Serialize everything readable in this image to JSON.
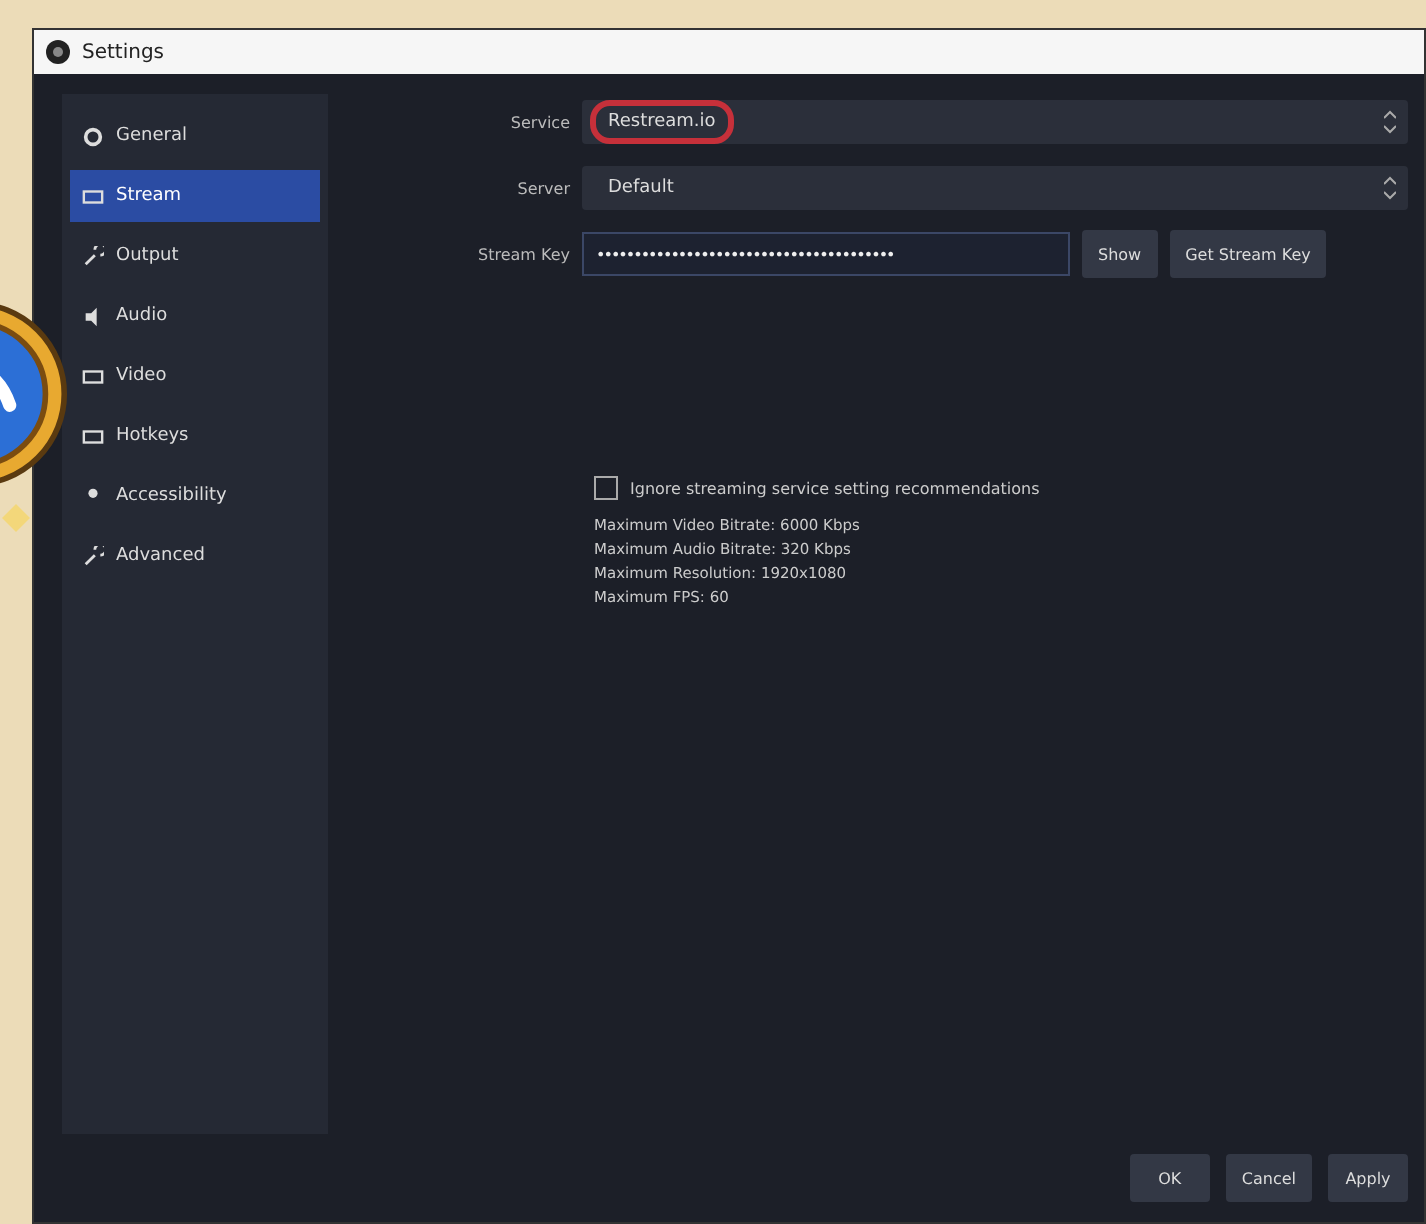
{
  "window": {
    "title": "Settings"
  },
  "sidebar": {
    "items": [
      {
        "label": "General",
        "selected": false
      },
      {
        "label": "Stream",
        "selected": true
      },
      {
        "label": "Output",
        "selected": false
      },
      {
        "label": "Audio",
        "selected": false
      },
      {
        "label": "Video",
        "selected": false
      },
      {
        "label": "Hotkeys",
        "selected": false
      },
      {
        "label": "Accessibility",
        "selected": false
      },
      {
        "label": "Advanced",
        "selected": false
      }
    ]
  },
  "form": {
    "rows": [
      {
        "kind": "select",
        "label": "Service",
        "value": "Restream.io",
        "highlighted": true
      },
      {
        "kind": "select",
        "label": "Server",
        "value": "Default",
        "highlighted": false
      },
      {
        "kind": "secret",
        "label": "Stream Key",
        "value": "••••••••••••••••••••••••••••••••••••••••",
        "highlighted": false,
        "buttons": [
          "Show",
          "Get Stream Key"
        ]
      }
    ]
  },
  "ignore_recommendations": {
    "label": "Ignore streaming service setting recommendations",
    "checked": false
  },
  "info_lines": [
    "Maximum Video Bitrate: 6000 Kbps",
    "Maximum Audio Bitrate: 320 Kbps",
    "Maximum Resolution: 1920x1080",
    "Maximum FPS: 60"
  ],
  "buttons": [
    "OK",
    "Cancel",
    "Apply"
  ]
}
